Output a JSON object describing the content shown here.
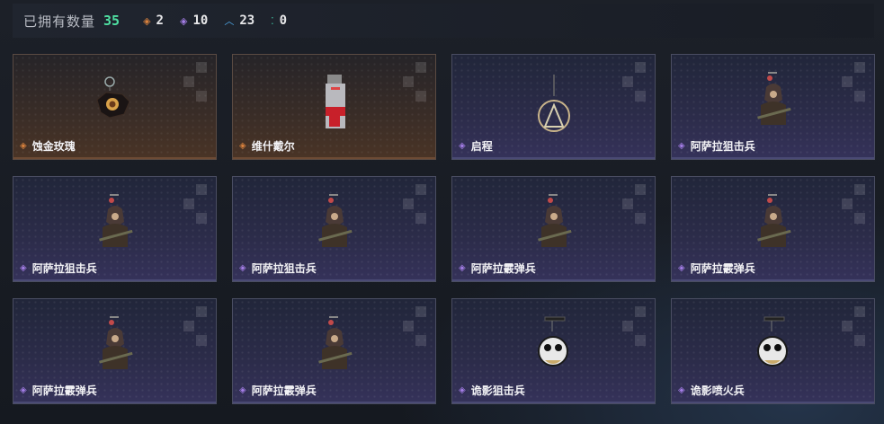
{
  "header": {
    "title": "已拥有数量",
    "total": "35",
    "stats": [
      {
        "icon": "orange-diamond-icon",
        "color": "#d9823e",
        "value": "2"
      },
      {
        "icon": "purple-diamond-icon",
        "color": "#a47ee6",
        "value": "10"
      },
      {
        "icon": "blue-chevron-icon",
        "color": "#4ea7e6",
        "value": "23"
      },
      {
        "icon": "teal-dots-icon",
        "color": "#40c6a6",
        "value": "0"
      }
    ]
  },
  "items": [
    {
      "name": "蚀金玫瑰",
      "rarity": "orange",
      "art": "pendant-rose"
    },
    {
      "name": "维什戴尔",
      "rarity": "orange",
      "art": "pendant-card"
    },
    {
      "name": "启程",
      "rarity": "purple",
      "art": "pendant-medal"
    },
    {
      "name": "阿萨拉狙击兵",
      "rarity": "purple",
      "art": "pendant-figure"
    },
    {
      "name": "阿萨拉狙击兵",
      "rarity": "purple",
      "art": "pendant-figure"
    },
    {
      "name": "阿萨拉狙击兵",
      "rarity": "purple",
      "art": "pendant-figure"
    },
    {
      "name": "阿萨拉霰弹兵",
      "rarity": "purple",
      "art": "pendant-figure"
    },
    {
      "name": "阿萨拉霰弹兵",
      "rarity": "purple",
      "art": "pendant-figure"
    },
    {
      "name": "阿萨拉霰弹兵",
      "rarity": "purple",
      "art": "pendant-figure"
    },
    {
      "name": "阿萨拉霰弹兵",
      "rarity": "purple",
      "art": "pendant-figure"
    },
    {
      "name": "诡影狙击兵",
      "rarity": "purple",
      "art": "pendant-ghost"
    },
    {
      "name": "诡影喷火兵",
      "rarity": "purple",
      "art": "pendant-ghost"
    }
  ]
}
